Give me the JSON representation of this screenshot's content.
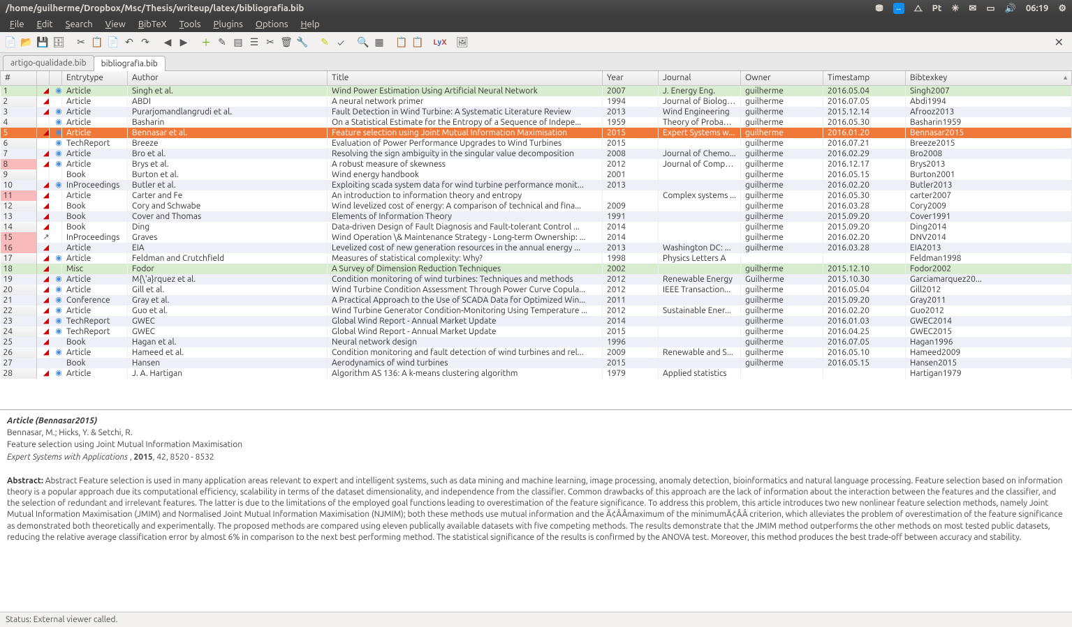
{
  "window": {
    "title": "/home/guilherme/Dropbox/Msc/Thesis/writeup/latex/bibliografia.bib"
  },
  "system": {
    "lang": "Pt",
    "time": "06:19"
  },
  "menu": [
    "File",
    "Edit",
    "Search",
    "View",
    "BibTeX",
    "Tools",
    "Plugins",
    "Options",
    "Help"
  ],
  "tabs": [
    {
      "label": "artigo-qualidade.bib",
      "active": false
    },
    {
      "label": "bibliografia.bib",
      "active": true
    }
  ],
  "columns": [
    "#",
    "",
    "",
    "Entrytype",
    "Author",
    "Title",
    "Year",
    "Journal",
    "Owner",
    "Timestamp",
    "Bibtexkey"
  ],
  "rows": [
    {
      "n": 1,
      "pdf": true,
      "web": true,
      "type": "Article",
      "author": "Singh et al.",
      "title": "Wind Power Estimation Using Artificial Neural Network",
      "year": "2007",
      "journal": "J. Energy Eng.",
      "owner": "guilherme",
      "ts": "2016.05.04",
      "key": "Singh2007",
      "green": true
    },
    {
      "n": 2,
      "pdf": true,
      "web": false,
      "type": "Article",
      "author": "ABDI",
      "title": "A neural network primer",
      "year": "1994",
      "journal": "Journal of Biologic...",
      "owner": "guilherme",
      "ts": "2016.07.05",
      "key": "Abdi1994"
    },
    {
      "n": 3,
      "pdf": true,
      "web": true,
      "type": "Article",
      "author": "Purarjomandlangrudi et al.",
      "title": "Fault Detection in Wind Turbine: A Systematic Literature Review",
      "year": "2013",
      "journal": "Wind Engineering",
      "owner": "guilherme",
      "ts": "2015.12.14",
      "key": "Afrooz2013",
      "alt": true
    },
    {
      "n": 4,
      "pdf": false,
      "web": true,
      "type": "Article",
      "author": "Basharin",
      "title": "On a Statistical Estimate for the Entropy of a Sequence of Indepe...",
      "year": "1959",
      "journal": "Theory of Probabi...",
      "owner": "guilherme",
      "ts": "2016.05.30",
      "key": "Basharin1959"
    },
    {
      "n": 5,
      "pdf": true,
      "web": true,
      "type": "Article",
      "author": "Bennasar et al.",
      "title": "Feature selection using Joint Mutual Information Maximisation",
      "year": "2015",
      "journal": "Expert Systems w...",
      "owner": "guilherme",
      "ts": "2016.01.20",
      "key": "Bennasar2015",
      "selected": true
    },
    {
      "n": 6,
      "pdf": false,
      "web": true,
      "type": "TechReport",
      "author": "Breeze",
      "title": "Evaluation of Power Performance Upgrades to Wind Turbines",
      "year": "2015",
      "journal": "",
      "owner": "guilherme",
      "ts": "2016.07.21",
      "key": "Breeze2015"
    },
    {
      "n": 7,
      "pdf": true,
      "web": true,
      "type": "Article",
      "author": "Bro et al.",
      "title": "Resolving the sign ambiguity in the singular value decomposition",
      "year": "2008",
      "journal": "Journal of Chemo...",
      "owner": "guilherme",
      "ts": "2016.02.29",
      "key": "Bro2008",
      "alt": true
    },
    {
      "n": 8,
      "pdf": true,
      "web": true,
      "type": "Article",
      "author": "Brys et al.",
      "title": "A robust measure of skewness",
      "year": "2012",
      "journal": "Journal of Comput...",
      "owner": "guilherme",
      "ts": "2016.12.17",
      "key": "Brys2013",
      "redidx": true
    },
    {
      "n": 9,
      "pdf": false,
      "web": false,
      "type": "Book",
      "author": "Burton et al.",
      "title": "Wind energy handbook",
      "year": "2001",
      "journal": "",
      "owner": "guilherme",
      "ts": "2016.05.15",
      "key": "Burton2001"
    },
    {
      "n": 10,
      "pdf": true,
      "web": true,
      "type": "InProceedings",
      "author": "Butler et al.",
      "title": "Exploiting scada system data for wind turbine performance monit...",
      "year": "2013",
      "journal": "",
      "owner": "guilherme",
      "ts": "2016.02.20",
      "key": "Butler2013",
      "alt": true
    },
    {
      "n": 11,
      "pdf": true,
      "web": false,
      "type": "Article",
      "author": "Carter and Fe",
      "title": "An introduction to information theory and entropy",
      "year": "",
      "journal": "Complex systems ...",
      "owner": "guilherme",
      "ts": "2016.05.30",
      "key": "carter2007",
      "redidx": true
    },
    {
      "n": 12,
      "pdf": true,
      "web": false,
      "type": "Book",
      "author": "Cory and Schwabe",
      "title": "Wind levelized cost of energy: A comparison of technical and fina...",
      "year": "2009",
      "journal": "",
      "owner": "guilherme",
      "ts": "2016.03.28",
      "key": "Cory2009"
    },
    {
      "n": 13,
      "pdf": true,
      "web": false,
      "type": "Book",
      "author": "Cover and Thomas",
      "title": "Elements of Information Theory",
      "year": "1991",
      "journal": "",
      "owner": "guilherme",
      "ts": "2015.09.20",
      "key": "Cover1991",
      "alt": true
    },
    {
      "n": 14,
      "pdf": true,
      "web": false,
      "type": "Book",
      "author": "Ding",
      "title": "Data-driven Design of Fault Diagnosis and Fault-tolerant Control ...",
      "year": "2014",
      "journal": "",
      "owner": "guilherme",
      "ts": "2015.09.20",
      "key": "Ding2014"
    },
    {
      "n": 15,
      "pdf": false,
      "web": false,
      "link": true,
      "type": "InProceedings",
      "author": "Graves",
      "title": "Wind Operation \\& Maintenance Strategy - Long-term Ownership: ...",
      "year": "2014",
      "journal": "",
      "owner": "guilherme",
      "ts": "2016.02.20",
      "key": "DNV2014",
      "redidx": true
    },
    {
      "n": 16,
      "pdf": true,
      "web": false,
      "type": "Article",
      "author": "EIA",
      "title": "Levelized cost of new generation resources in the annual energy ...",
      "year": "2013",
      "journal": "Washington DC: ...",
      "owner": "guilherme",
      "ts": "2016.03.28",
      "key": "EIA2013",
      "redidx": true,
      "alt": true
    },
    {
      "n": 17,
      "pdf": true,
      "web": true,
      "type": "Article",
      "author": "Feldman and Crutchfield",
      "title": "Measures of statistical complexity: Why?",
      "year": "1998",
      "journal": "Physics Letters A",
      "owner": "",
      "ts": "",
      "key": "Feldman1998"
    },
    {
      "n": 18,
      "pdf": true,
      "web": false,
      "type": "Misc",
      "author": "Fodor",
      "title": "A Survey of Dimension Reduction Techniques",
      "year": "2002",
      "journal": "",
      "owner": "guilherme",
      "ts": "2015.12.10",
      "key": "Fodor2002",
      "green": true
    },
    {
      "n": 19,
      "pdf": true,
      "web": true,
      "type": "Article",
      "author": "M{\\'a}rquez et al.",
      "title": "Condition monitoring of wind turbines: Techniques and methods",
      "year": "2012",
      "journal": "Renewable Energy",
      "owner": "Guilherme",
      "ts": "2015.10.30",
      "key": "Garciamarquez20...",
      "alt": true
    },
    {
      "n": 20,
      "pdf": true,
      "web": true,
      "type": "Article",
      "author": "Gill et al.",
      "title": "Wind Turbine Condition Assessment Through Power Curve Copula...",
      "year": "2012",
      "journal": "IEEE Transaction...",
      "owner": "guilherme",
      "ts": "2016.05.04",
      "key": "Gill2012"
    },
    {
      "n": 21,
      "pdf": true,
      "web": true,
      "type": "Conference",
      "author": "Gray et al.",
      "title": "A Practical Approach to the Use of SCADA Data for Optimized Win...",
      "year": "2011",
      "journal": "",
      "owner": "guilherme",
      "ts": "2015.09.20",
      "key": "Gray2011",
      "alt": true
    },
    {
      "n": 22,
      "pdf": true,
      "web": true,
      "type": "Article",
      "author": "Guo et al.",
      "title": "Wind Turbine Generator Condition-Monitoring Using Temperature ...",
      "year": "2012",
      "journal": "Sustainable Ener...",
      "owner": "guilherme",
      "ts": "2016.02.20",
      "key": "Guo2012"
    },
    {
      "n": 23,
      "pdf": true,
      "web": true,
      "type": "TechReport",
      "author": "GWEC",
      "title": "Global Wind Report - Annual Market Update",
      "year": "2014",
      "journal": "",
      "owner": "guilherme",
      "ts": "2016.01.03",
      "key": "GWEC2014",
      "alt": true
    },
    {
      "n": 24,
      "pdf": true,
      "web": true,
      "type": "TechReport",
      "author": "GWEC",
      "title": "Global Wind Report - Annual Market Update",
      "year": "2015",
      "journal": "",
      "owner": "guilherme",
      "ts": "2016.04.25",
      "key": "GWEC2015"
    },
    {
      "n": 25,
      "pdf": true,
      "web": false,
      "type": "Book",
      "author": "Hagan et al.",
      "title": "Neural network design",
      "year": "1996",
      "journal": "",
      "owner": "guilherme",
      "ts": "2016.07.05",
      "key": "Hagan1996",
      "alt": true
    },
    {
      "n": 26,
      "pdf": true,
      "web": true,
      "type": "Article",
      "author": "Hameed et al.",
      "title": "Condition monitoring and fault detection of wind turbines and rel...",
      "year": "2009",
      "journal": "Renewable and S...",
      "owner": "guilherme",
      "ts": "2016.05.10",
      "key": "Hameed2009"
    },
    {
      "n": 27,
      "pdf": false,
      "web": false,
      "type": "Book",
      "author": "Hansen",
      "title": "Aerodynamics of wind turbines",
      "year": "2015",
      "journal": "",
      "owner": "guilherme",
      "ts": "2016.05.15",
      "key": "Hansen2015",
      "alt": true
    },
    {
      "n": 28,
      "pdf": true,
      "web": true,
      "type": "Article",
      "author": "J. A. Hartigan",
      "title": "Algorithm AS 136: A k-means clustering algorithm",
      "year": "1979",
      "journal": "Applied statistics",
      "owner": "",
      "ts": "",
      "key": "Hartigan1979"
    }
  ],
  "preview": {
    "etype": "Article",
    "key": "Bennasar2015",
    "authors": "Bennasar, M.; Hicks, Y. & Setchi, R.",
    "title": "Feature selection using Joint Mutual Information Maximisation",
    "journal": "Expert Systems with Applications",
    "year": "2015",
    "vol_pages": "42, 8520 - 8532",
    "abstract_label": "Abstract:",
    "abstract": "Abstract Feature selection is used in many application areas relevant to expert and intelligent systems, such as data mining and machine learning, image processing, anomaly detection, bioinformatics and natural language processing. Feature selection based on information theory is a popular approach due its computational efficiency, scalability in terms of the dataset dimensionality, and independence from the classifier. Common drawbacks of this approach are the lack of information about the interaction between the features and the classifier, and the selection of redundant and irrelevant features. The latter is due to the limitations of the employed goal functions leading to overestimation of the feature significance. To address this problem, this article introduces two new nonlinear feature selection methods, namely Joint Mutual Information Maximisation (JMIM) and Normalised Joint Mutual Information Maximisation (NJMIM); both these methods use mutual information and the Ã¢ÂÂmaximum of the minimumÃ¢ÂÂ criterion, which alleviates the problem of overestimation of the feature significance as demonstrated both theoretically and experimentally. The proposed methods are compared using eleven publically available datasets with five competing methods. The results demonstrate that the JMIM method outperforms the other methods on most tested public datasets, reducing the relative average classification error by almost 6% in comparison to the next best performing method. The statistical significance of the results is confirmed by the ANOVA test. Moreover, this method produces the best trade-off between accuracy and stability."
  },
  "status": "Status: External viewer called."
}
